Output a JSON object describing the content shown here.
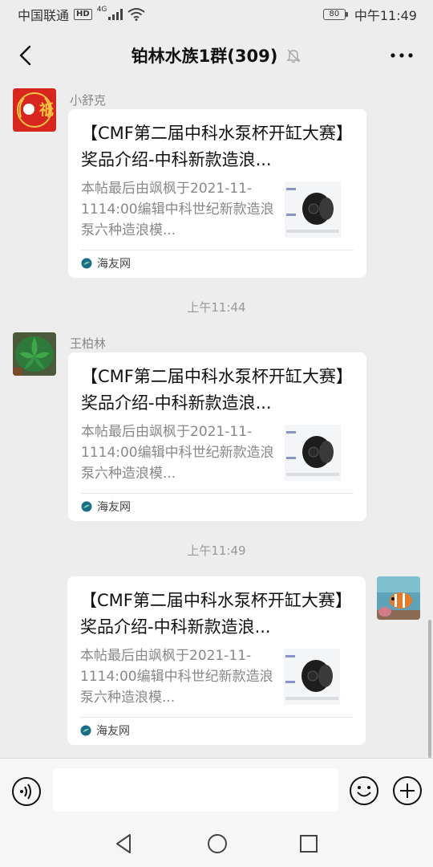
{
  "status_bar": {
    "carrier": "中国联通",
    "hd": "HD",
    "network": "4G",
    "battery": "80",
    "time": "中午11:49"
  },
  "header": {
    "title": "铂林水族1群(309)",
    "mute_icon": "bell-off-icon",
    "more_icon": "more-dots-icon",
    "back_icon": "chevron-left-icon"
  },
  "messages": [
    {
      "sender": "小舒克",
      "side": "left",
      "card": {
        "title": "【CMF第二届中科水泵杯开缸大赛】奖品介绍-中科新款造浪...",
        "desc": "本帖最后由飒枫于2021-11-1114:00编辑中科世纪新款造浪泵六种造浪模...",
        "source": "海友网"
      }
    },
    {
      "timestamp": "上午11:44"
    },
    {
      "sender": "王柏林",
      "side": "left",
      "card": {
        "title": "【CMF第二届中科水泵杯开缸大赛】奖品介绍-中科新款造浪...",
        "desc": "本帖最后由飒枫于2021-11-1114:00编辑中科世纪新款造浪泵六种造浪模...",
        "source": "海友网"
      }
    },
    {
      "timestamp": "上午11:49"
    },
    {
      "sender": "",
      "side": "right",
      "card": {
        "title": "【CMF第二届中科水泵杯开缸大赛】奖品介绍-中科新款造浪...",
        "desc": "本帖最后由飒枫于2021-11-1114:00编辑中科世纪新款造浪泵六种造浪模...",
        "source": "海友网"
      }
    }
  ],
  "input_bar": {
    "placeholder": "",
    "voice_icon": "voice-icon",
    "emoji_icon": "emoji-icon",
    "plus_icon": "plus-icon"
  },
  "nav_bar": {
    "back_icon": "nav-back-triangle-icon",
    "home_icon": "nav-home-circle-icon",
    "recent_icon": "nav-recent-square-icon"
  },
  "colors": {
    "background": "#ededed",
    "card": "#ffffff",
    "source_icon": "#1a6e8a",
    "avatar1_red": "#d7261e"
  }
}
